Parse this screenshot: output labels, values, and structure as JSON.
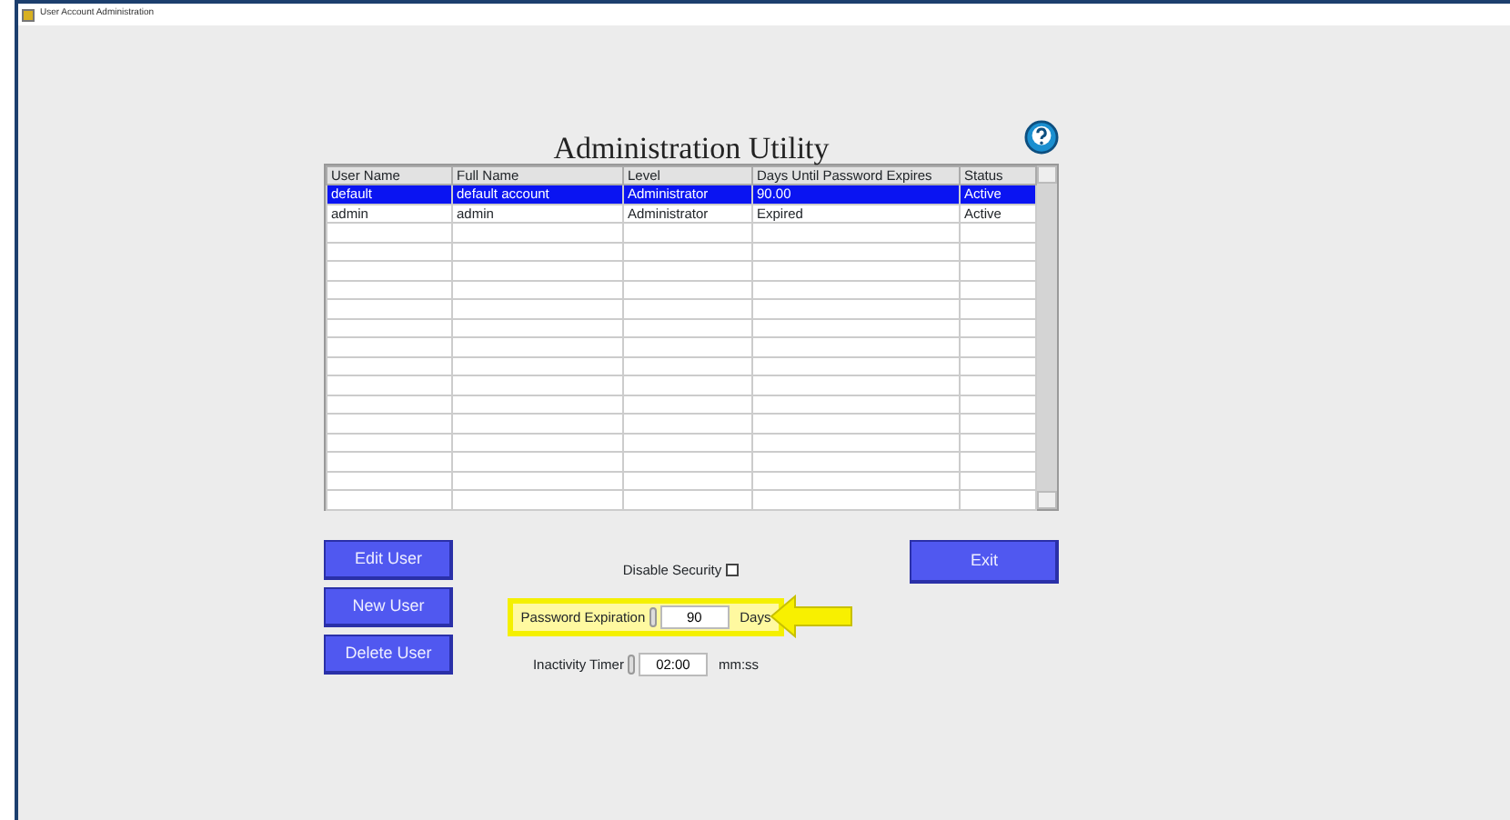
{
  "window": {
    "title": "User Account Administration"
  },
  "heading": "Administration Utility",
  "table": {
    "columns": [
      "User Name",
      "Full Name",
      "Level",
      "Days Until Password Expires",
      "Status"
    ],
    "rows": [
      {
        "cells": [
          "default",
          "default account",
          "Administrator",
          "90.00",
          "Active"
        ],
        "selected": true
      },
      {
        "cells": [
          "admin",
          "admin",
          "Administrator",
          "Expired",
          "Active"
        ],
        "selected": false
      }
    ]
  },
  "buttons": [
    "Edit User",
    "New User",
    "Delete User"
  ],
  "exit_button": "Exit",
  "settings": {
    "disable_security": {
      "label": "Disable Security",
      "checked": false
    },
    "password_expiration": {
      "label": "Password Expiration",
      "value": "90",
      "unit": "Days",
      "highlighted": true
    },
    "inactivity_timer": {
      "label": "Inactivity Timer",
      "value": "02:00",
      "unit": "mm:ss",
      "highlighted": false
    }
  }
}
